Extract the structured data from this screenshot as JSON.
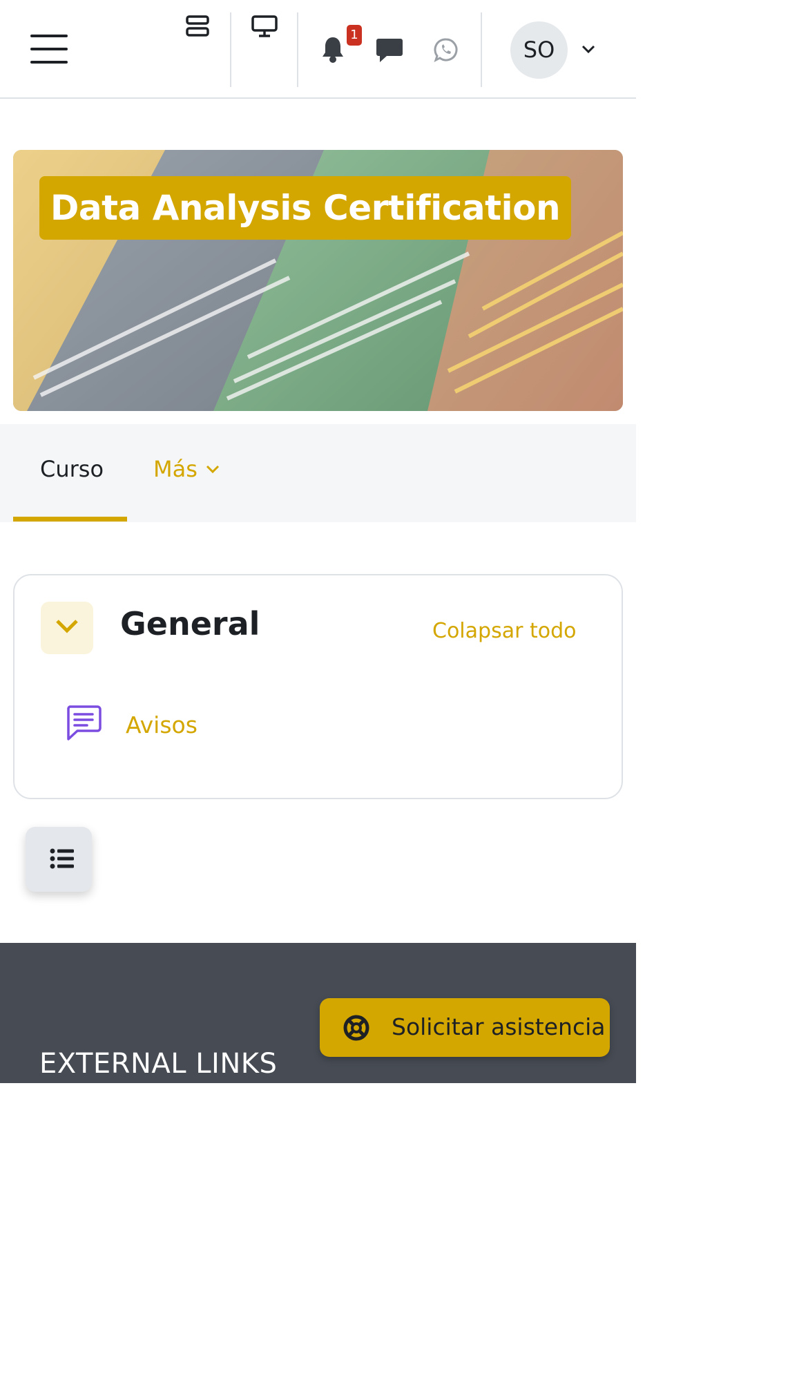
{
  "header": {
    "notification_count": "1",
    "user_initials": "SO"
  },
  "course": {
    "title": "Data Analysis Certification"
  },
  "secondary_nav": {
    "tabs": [
      {
        "label": "Curso",
        "active": true
      },
      {
        "label": "Más",
        "active": false
      }
    ]
  },
  "section": {
    "title": "General",
    "collapse_all_label": "Colapsar todo",
    "activities": [
      {
        "label": "Avisos",
        "icon": "forum-icon"
      }
    ]
  },
  "footer": {
    "heading": "EXTERNAL LINKS",
    "help_button_label": "Solicitar asistencia"
  },
  "colors": {
    "accent": "#d4a600",
    "footer_bg": "#474c54",
    "badge": "#ca3120",
    "forum_icon": "#7b4ce0"
  }
}
